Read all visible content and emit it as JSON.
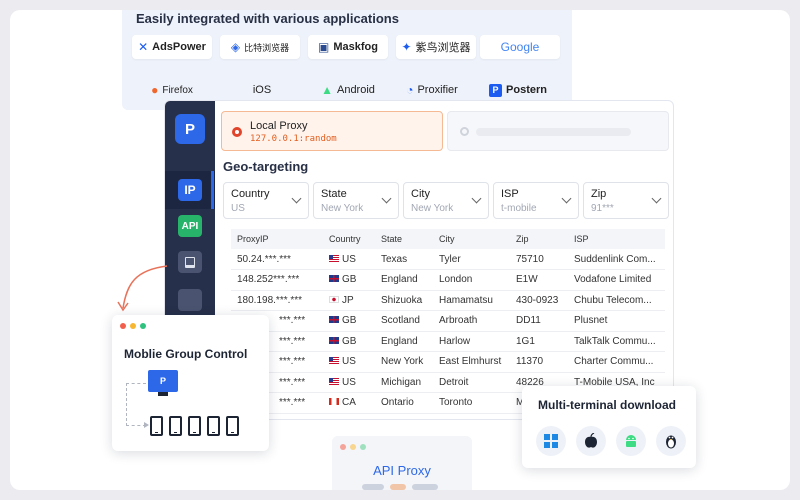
{
  "integrations": {
    "title": "Easily integrated with various applications",
    "apps": [
      {
        "name": "AdsPower",
        "icon": "adspower-icon"
      },
      {
        "name": "比特浏览器",
        "icon": "bitbrowser-icon"
      },
      {
        "name": "Maskfog",
        "icon": "maskfog-icon"
      },
      {
        "name": "紫鸟浏览器",
        "icon": "ziniao-icon"
      },
      {
        "name": "Google",
        "icon": "google-icon"
      },
      {
        "name": "Firefox",
        "icon": "firefox-icon"
      },
      {
        "name": "iOS",
        "icon": "apple-icon"
      },
      {
        "name": "Android",
        "icon": "android-icon"
      },
      {
        "name": "Proxifier",
        "icon": "proxifier-icon"
      },
      {
        "name": "Postern",
        "icon": "postern-icon"
      }
    ]
  },
  "sidebar": {
    "items": [
      {
        "label": "IP",
        "active": true
      },
      {
        "label": "API"
      },
      {
        "label": ""
      },
      {
        "label": ""
      }
    ]
  },
  "local_proxy": {
    "title": "Local Proxy",
    "address": "127.0.0.1:random"
  },
  "geo": {
    "title": "Geo-targeting",
    "filters": [
      {
        "label": "Country",
        "value": "US"
      },
      {
        "label": "State",
        "value": "New York"
      },
      {
        "label": "City",
        "value": "New York"
      },
      {
        "label": "ISP",
        "value": "t-mobile"
      },
      {
        "label": "Zip",
        "value": "91***"
      }
    ]
  },
  "table": {
    "headers": [
      "ProxyIP",
      "Country",
      "State",
      "City",
      "Zip",
      "ISP"
    ],
    "rows": [
      {
        "ip": "50.24.***.***",
        "country": "US",
        "state": "Texas",
        "city": "Tyler",
        "zip": "75710",
        "isp": "Suddenlink Com..."
      },
      {
        "ip": "148.252***.***",
        "country": "GB",
        "state": "England",
        "city": "London",
        "zip": "E1W",
        "isp": "Vodafone Limited"
      },
      {
        "ip": "180.198.***.***",
        "country": "JP",
        "state": "Shizuoka",
        "city": "Hamamatsu",
        "zip": "430-0923",
        "isp": "Chubu Telecom..."
      },
      {
        "ip": "***.***",
        "country": "GB",
        "state": "Scotland",
        "city": "Arbroath",
        "zip": "DD11",
        "isp": "Plusnet"
      },
      {
        "ip": "***.***",
        "country": "GB",
        "state": "England",
        "city": "Harlow",
        "zip": "1G1",
        "isp": "TalkTalk Commu..."
      },
      {
        "ip": "***.***",
        "country": "US",
        "state": "New York",
        "city": "East Elmhurst",
        "zip": "11370",
        "isp": "Charter Commu..."
      },
      {
        "ip": "***.***",
        "country": "US",
        "state": "Michigan",
        "city": "Detroit",
        "zip": "48226",
        "isp": "T-Mobile USA, Inc"
      },
      {
        "ip": "***.***",
        "country": "CA",
        "state": "Ontario",
        "city": "Toronto",
        "zip": "M",
        "isp": ""
      }
    ]
  },
  "mobile_group": {
    "title": "Moblie Group Control"
  },
  "multi_terminal": {
    "title": "Multi-terminal download",
    "platforms": [
      "windows-icon",
      "apple-icon",
      "android-icon",
      "linux-icon"
    ]
  },
  "api_proxy": {
    "title": "API Proxy"
  },
  "colors": {
    "accent": "#2d68e8",
    "sidebar": "#27304a",
    "proxy_highlight": "#fff3ec",
    "proxy_text": "#e25e1f"
  }
}
